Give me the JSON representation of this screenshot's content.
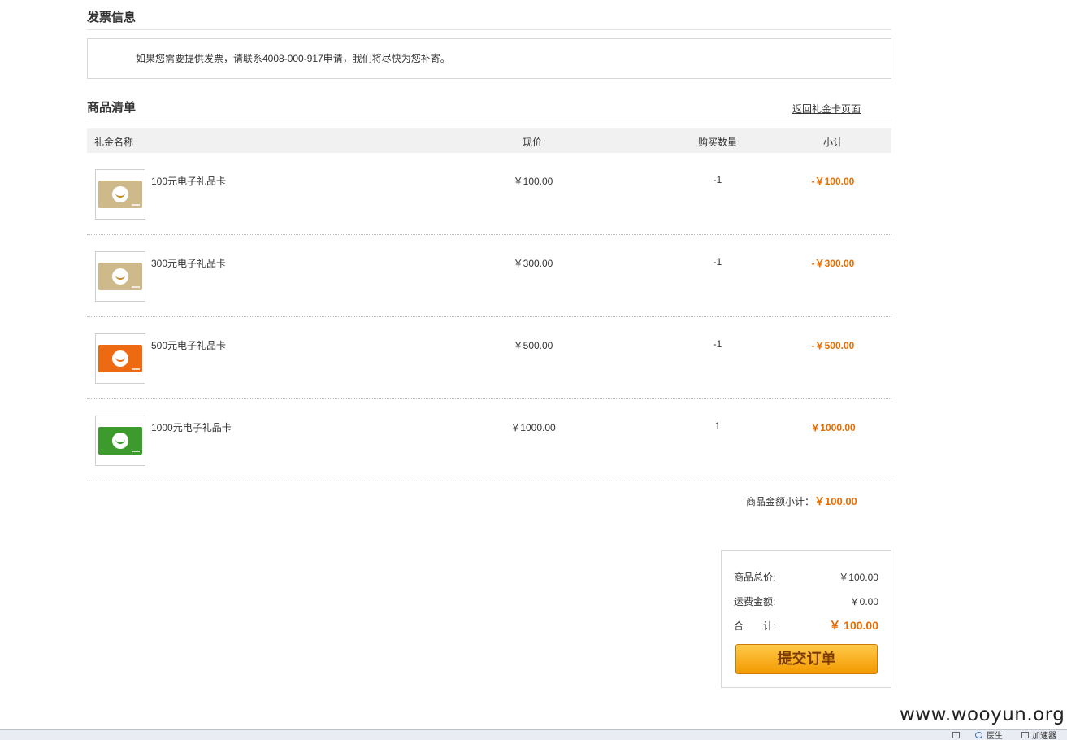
{
  "invoice": {
    "title": "发票信息",
    "note": "如果您需要提供发票，请联系4008-000-917申请，我们将尽快为您补寄。"
  },
  "goods": {
    "title": "商品清单",
    "back_link": "返回礼金卡页面",
    "headers": {
      "name": "礼金名称",
      "price": "现价",
      "qty": "购买数量",
      "subtotal": "小计"
    },
    "rows": [
      {
        "name": "100元电子礼品卡",
        "price": "￥100.00",
        "qty": "-1",
        "subtotal": "-￥100.00",
        "card_color": "#cdb98a",
        "smile_color": "#c98a2a"
      },
      {
        "name": "300元电子礼品卡",
        "price": "￥300.00",
        "qty": "-1",
        "subtotal": "-￥300.00",
        "card_color": "#cdb98a",
        "smile_color": "#c98a2a"
      },
      {
        "name": "500元电子礼品卡",
        "price": "￥500.00",
        "qty": "-1",
        "subtotal": "-￥500.00",
        "card_color": "#ee6a12",
        "smile_color": "#ee6a12"
      },
      {
        "name": "1000元电子礼品卡",
        "price": "￥1000.00",
        "qty": "1",
        "subtotal": "￥1000.00",
        "card_color": "#3d9a2c",
        "smile_color": "#3d9a2c"
      }
    ],
    "subtotal_label": "商品金额小计：",
    "subtotal_value": "￥100.00"
  },
  "summary": {
    "goods_total_label": "商品总价:",
    "goods_total_value": "￥100.00",
    "shipping_label": "运费金额:",
    "shipping_value": "￥0.00",
    "total_label": "合　　计:",
    "total_value": "￥ 100.00",
    "submit_label": "提交订单"
  },
  "watermark": "www.wooyun.org",
  "statusbar": {
    "item1": "医生",
    "item2": "加速器"
  },
  "colors": {
    "accent": "#e86d00",
    "button_top": "#ffc94a",
    "button_bottom": "#f39a00"
  }
}
